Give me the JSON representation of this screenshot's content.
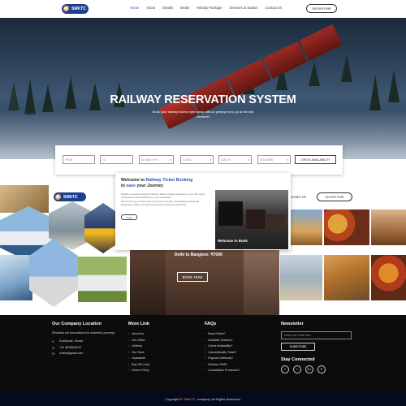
{
  "brand": {
    "logo_text": "SMKTC"
  },
  "nav": {
    "items": [
      {
        "label": "Home"
      },
      {
        "label": "About"
      },
      {
        "label": "Details"
      },
      {
        "label": "Meals"
      },
      {
        "label": "Holiday Package"
      },
      {
        "label": "Services at Station"
      },
      {
        "label": "Contact Us"
      }
    ],
    "active_index": 0,
    "pnr_button": "ENTER PNR"
  },
  "hero": {
    "title": "RAILWAY RESERVATION SYSTEM",
    "subtitle_line1": "Book your railway tickets right away without getting hurry up at the last",
    "subtitle_line2": "moment!"
  },
  "search": {
    "from_placeholder": "FROM",
    "to_placeholder": "TO",
    "date_placeholder": "DD-MM-YYYY",
    "class_label": "CLASS",
    "adults_label": "ADULTS",
    "children_label": "CHILDREN",
    "check_button": "CHECK AVAILABILITY"
  },
  "second_nav": {
    "logo_text": "SMKTC",
    "contact_label": "Contact Us",
    "pnr_button": "ENTER PNR"
  },
  "welcome": {
    "title_prefix": "Welcome to ",
    "title_highlight": "Railway Ticket Booking",
    "title_line2_prefix": "to ",
    "title_line2_highlight": "ease",
    "title_line2_suffix": " your Journey",
    "para1": "Explore a seamless and user-friendly railway booking experience on our site, where convenience meets efficiency for your travel plans.",
    "para2": "Discover the joy of hassle-free journeys as you plan your Railway booking trip. Designed to make your travel experience smooth and stress-free.",
    "more_button": "more",
    "image_badge": "Welcome to Book"
  },
  "offer": {
    "route": "Delhi to Banglore: ₹7000",
    "button": "BOOK NOW"
  },
  "footer": {
    "location": {
      "heading": "Our Company Location",
      "tagline": "Effortless rail reservations for seamless journeys",
      "address": "Kozhikode, Kerala",
      "phone": "+91 9876543210",
      "email": "smktc@gmail.com"
    },
    "links": {
      "heading": "More Link",
      "items": [
        "About Us",
        "Our Office",
        "Delivery",
        "Our Store",
        "Guarantee",
        "Buy Gift Card",
        "Return Policy"
      ]
    },
    "faqs": {
      "heading": "FAQs",
      "items": [
        "Book Online?",
        "Available Classes?",
        "Check Availability?",
        "Cancel/Modify Ticket?",
        "Payment Methods?",
        "Retrieve PNR?",
        "Cancellation Procedure?"
      ]
    },
    "newsletter": {
      "heading": "Newsletter",
      "email_placeholder": "Enter your Email here",
      "subscribe_button": "SUBSCRIBE",
      "social_heading": "Stay Connected",
      "socials": [
        "f",
        "t",
        "G+",
        "P"
      ]
    },
    "copyright_prefix": "Copyright ©",
    "copyright_brand": "SMKTC",
    "copyright_suffix": "company. All Rights Reserved."
  },
  "colors": {
    "accent": "#2f56b0",
    "footer_bg": "#0c0c0c",
    "highlight": "#f5a623"
  }
}
